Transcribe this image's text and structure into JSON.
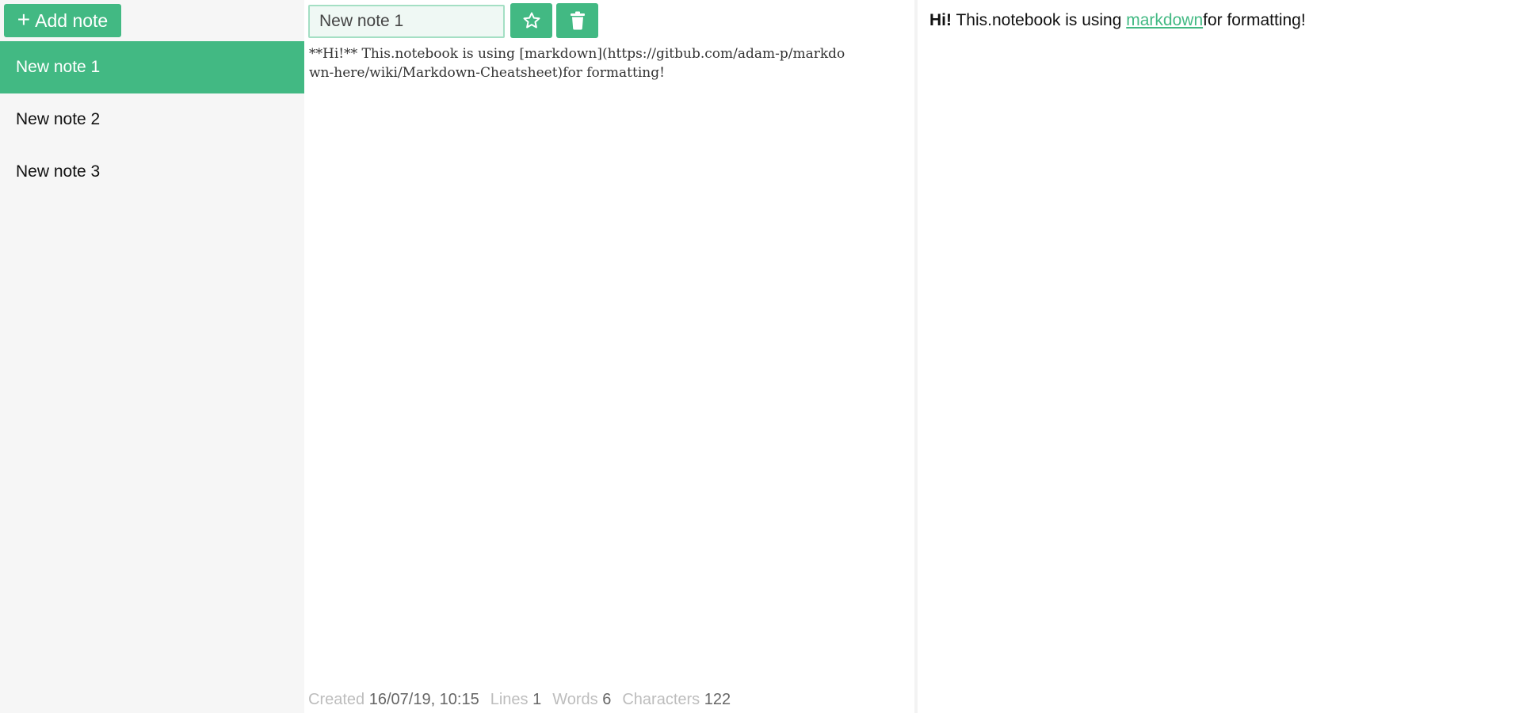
{
  "sidebar": {
    "add_button_label": "Add note",
    "notes": [
      {
        "label": "New note 1",
        "active": true
      },
      {
        "label": "New note 2",
        "active": false
      },
      {
        "label": "New note 3",
        "active": false
      }
    ]
  },
  "editor": {
    "title_value": "New note 1",
    "star_icon": "star-outline-icon",
    "trash_icon": "trash-icon",
    "content": "**Hi!** This.notebook is using [markdown](https://gitbub.com/adam-p/markdown-here/wiki/Markdown-Cheatsheet)for formatting!",
    "status": {
      "created_label": "Created",
      "created_value": "16/07/19, 10:15",
      "lines_label": "Lines",
      "lines_value": "1",
      "words_label": "Words",
      "words_value": "6",
      "characters_label": "Characters",
      "characters_value": "122"
    }
  },
  "preview": {
    "bold_text": "Hi!",
    "text_before_link": " This.notebook is using ",
    "link_text": "markdown",
    "text_after_link": "for formatting!"
  },
  "colors": {
    "accent": "#42b983",
    "sidebar_bg": "#f6f6f6",
    "input_border": "#a4dfc4",
    "input_bg": "#eff8f4"
  }
}
